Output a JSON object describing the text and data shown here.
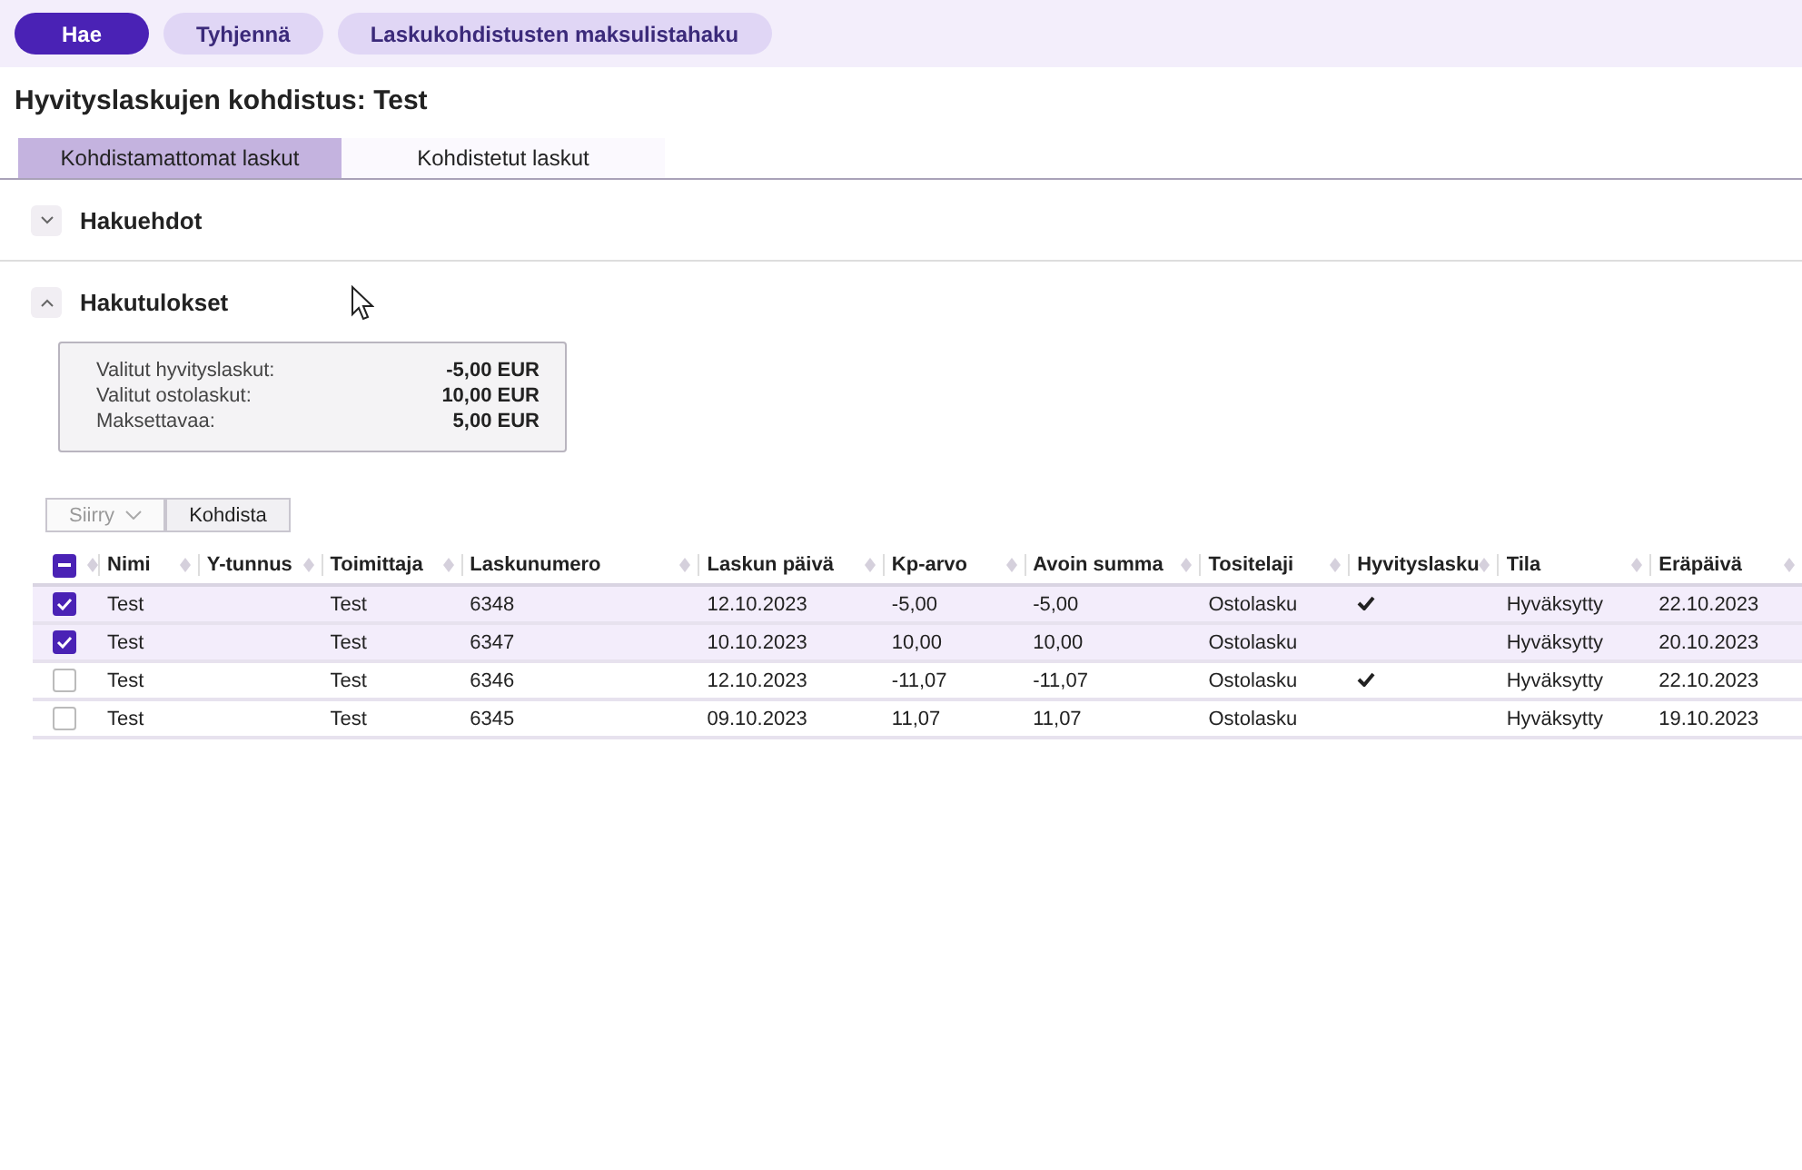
{
  "toolbar": {
    "buttons": [
      {
        "label": "Hae",
        "kind": "primary"
      },
      {
        "label": "Tyhjennä",
        "kind": "secondary"
      },
      {
        "label": "Laskukohdistusten maksulistahaku",
        "kind": "secondary"
      }
    ]
  },
  "page_title": "Hyvityslaskujen kohdistus: Test",
  "tabs": [
    {
      "label": "Kohdistamattomat laskut",
      "selected": true
    },
    {
      "label": "Kohdistetut laskut",
      "selected": false
    }
  ],
  "sections": [
    {
      "title": "Hakuehdot",
      "expanded": false
    },
    {
      "title": "Hakutulokset",
      "expanded": true
    }
  ],
  "summary": [
    {
      "label": "Valitut hyvityslaskut:",
      "value": "-5,00 EUR"
    },
    {
      "label": "Valitut ostolaskut:",
      "value": "10,00 EUR"
    },
    {
      "label": "Maksettavaa:",
      "value": "5,00 EUR"
    }
  ],
  "actions": {
    "move": {
      "label": "Siirry",
      "disabled": true
    },
    "allocate": {
      "label": "Kohdista"
    }
  },
  "table": {
    "select_all": {
      "indeterminate": true
    },
    "columns": [
      "Nimi",
      "Y-tunnus",
      "Toimittaja",
      "Laskunumero",
      "Laskun päivä",
      "Kp-arvo",
      "Avoin summa",
      "Tositelaji",
      "Hyvityslasku",
      "Tila",
      "Eräpäivä"
    ],
    "rows": [
      {
        "selected": true,
        "credit_note": true,
        "cells": [
          "Test",
          "",
          "Test",
          "6348",
          "12.10.2023",
          "-5,00",
          "-5,00",
          "Ostolasku",
          "",
          "Hyväksytty",
          "22.10.2023"
        ]
      },
      {
        "selected": true,
        "credit_note": false,
        "cells": [
          "Test",
          "",
          "Test",
          "6347",
          "10.10.2023",
          "10,00",
          "10,00",
          "Ostolasku",
          "",
          "Hyväksytty",
          "20.10.2023"
        ]
      },
      {
        "selected": false,
        "credit_note": true,
        "cells": [
          "Test",
          "",
          "Test",
          "6346",
          "12.10.2023",
          "-11,07",
          "-11,07",
          "Ostolasku",
          "",
          "Hyväksytty",
          "22.10.2023"
        ]
      },
      {
        "selected": false,
        "credit_note": false,
        "cells": [
          "Test",
          "",
          "Test",
          "6345",
          "09.10.2023",
          "11,07",
          "11,07",
          "Ostolasku",
          "",
          "Hyväksytty",
          "19.10.2023"
        ]
      }
    ]
  }
}
